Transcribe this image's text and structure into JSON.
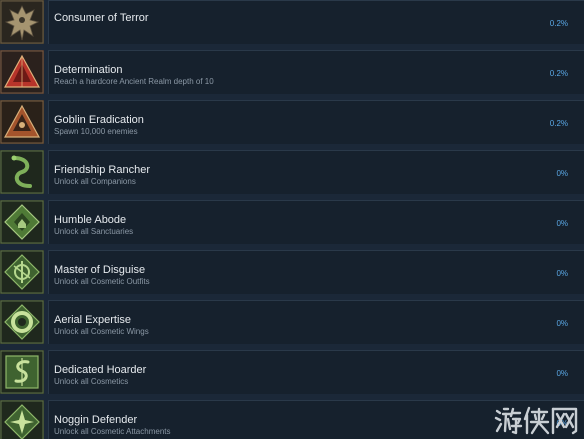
{
  "achievements": [
    {
      "title": "Consumer of Terror",
      "description": "",
      "percent": "0.2%",
      "icon": "winged-demon-icon"
    },
    {
      "title": "Determination",
      "description": "Reach a hardcore Ancient Realm depth of 10",
      "percent": "0.2%",
      "icon": "red-triangle-icon"
    },
    {
      "title": "Goblin Eradication",
      "description": "Spawn 10,000 enemies",
      "percent": "0.2%",
      "icon": "eye-pyramid-icon"
    },
    {
      "title": "Friendship Rancher",
      "description": "Unlock all Companions",
      "percent": "0%",
      "icon": "serpent-icon"
    },
    {
      "title": "Humble Abode",
      "description": "Unlock all Sanctuaries",
      "percent": "0%",
      "icon": "diamond-house-icon"
    },
    {
      "title": "Master of Disguise",
      "description": "Unlock all Cosmetic Outfits",
      "percent": "0%",
      "icon": "rune-icon"
    },
    {
      "title": "Aerial Expertise",
      "description": "Unlock all Cosmetic Wings",
      "percent": "0%",
      "icon": "ring-icon"
    },
    {
      "title": "Dedicated Hoarder",
      "description": "Unlock all Cosmetics",
      "percent": "0%",
      "icon": "coiled-coin-icon"
    },
    {
      "title": "Noggin Defender",
      "description": "Unlock all Cosmetic Attachments",
      "percent": "0%",
      "icon": "helmet-icon"
    }
  ],
  "watermark": {
    "text": "游侠网"
  },
  "colors": {
    "background": "#1b2838",
    "panel": "#16212d",
    "title": "#e6eaee",
    "description": "#8b98a5",
    "percent": "#5aa8e6",
    "icon_red": "#b8342a",
    "icon_green": "#6fa04a",
    "icon_gold": "#b49a5c"
  }
}
